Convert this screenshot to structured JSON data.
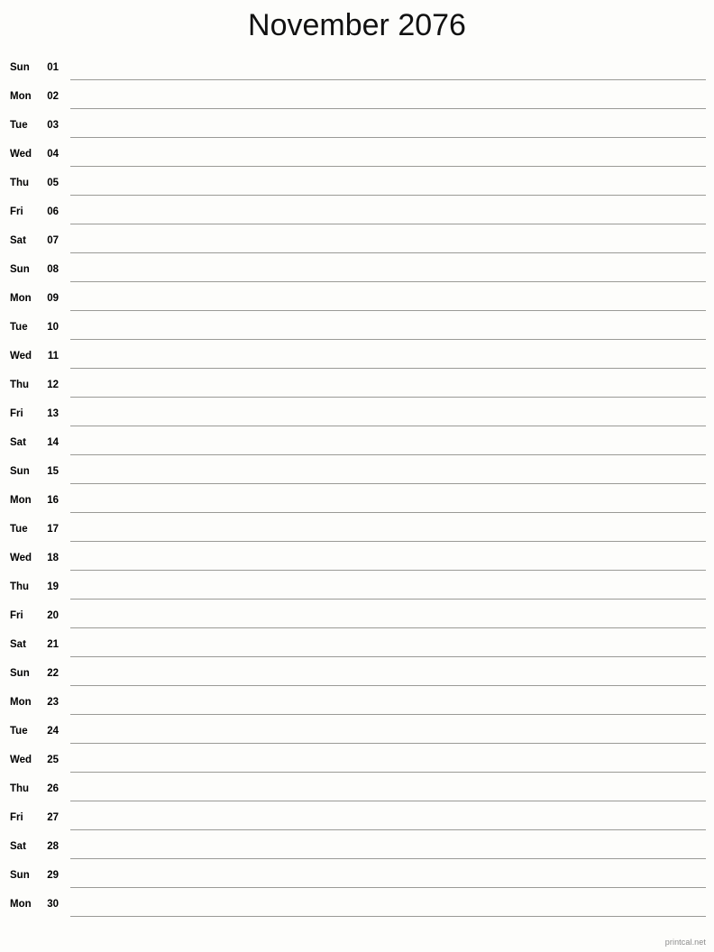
{
  "header": {
    "title": "November 2076",
    "month_name": "November",
    "year": "2076"
  },
  "footer": {
    "credit": "printcal.net"
  },
  "colors": {
    "page_background": "#fdfdfb",
    "title_text": "#111111",
    "row_text": "#000000",
    "rule_line": "#9a9a96",
    "footer_text": "#8a8a8a"
  },
  "calendar": {
    "layout": "single-column-notes-list",
    "days_in_month": 30,
    "first_weekday": "Sun",
    "rows": [
      {
        "weekday": "Sun",
        "date": "01"
      },
      {
        "weekday": "Mon",
        "date": "02"
      },
      {
        "weekday": "Tue",
        "date": "03"
      },
      {
        "weekday": "Wed",
        "date": "04"
      },
      {
        "weekday": "Thu",
        "date": "05"
      },
      {
        "weekday": "Fri",
        "date": "06"
      },
      {
        "weekday": "Sat",
        "date": "07"
      },
      {
        "weekday": "Sun",
        "date": "08"
      },
      {
        "weekday": "Mon",
        "date": "09"
      },
      {
        "weekday": "Tue",
        "date": "10"
      },
      {
        "weekday": "Wed",
        "date": "11"
      },
      {
        "weekday": "Thu",
        "date": "12"
      },
      {
        "weekday": "Fri",
        "date": "13"
      },
      {
        "weekday": "Sat",
        "date": "14"
      },
      {
        "weekday": "Sun",
        "date": "15"
      },
      {
        "weekday": "Mon",
        "date": "16"
      },
      {
        "weekday": "Tue",
        "date": "17"
      },
      {
        "weekday": "Wed",
        "date": "18"
      },
      {
        "weekday": "Thu",
        "date": "19"
      },
      {
        "weekday": "Fri",
        "date": "20"
      },
      {
        "weekday": "Sat",
        "date": "21"
      },
      {
        "weekday": "Sun",
        "date": "22"
      },
      {
        "weekday": "Mon",
        "date": "23"
      },
      {
        "weekday": "Tue",
        "date": "24"
      },
      {
        "weekday": "Wed",
        "date": "25"
      },
      {
        "weekday": "Thu",
        "date": "26"
      },
      {
        "weekday": "Fri",
        "date": "27"
      },
      {
        "weekday": "Sat",
        "date": "28"
      },
      {
        "weekday": "Sun",
        "date": "29"
      },
      {
        "weekday": "Mon",
        "date": "30"
      }
    ]
  }
}
